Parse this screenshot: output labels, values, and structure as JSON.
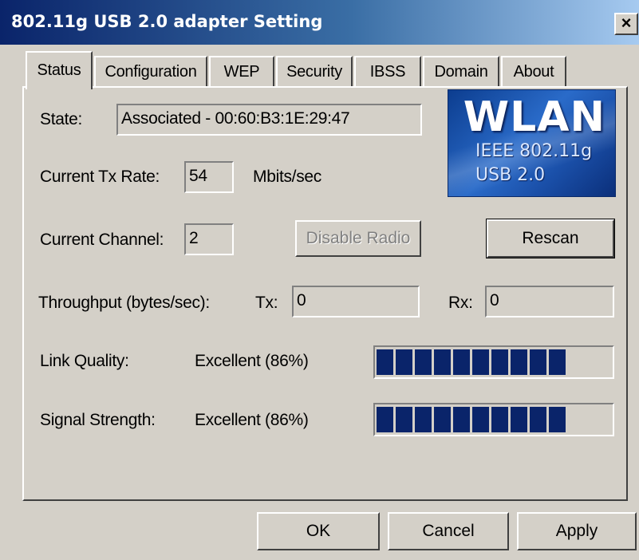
{
  "window": {
    "title": "802.11g USB 2.0 adapter Setting",
    "close_label": "×"
  },
  "tabs": [
    {
      "label": "Status",
      "active": true
    },
    {
      "label": "Configuration",
      "active": false
    },
    {
      "label": "WEP",
      "active": false
    },
    {
      "label": "Security",
      "active": false
    },
    {
      "label": "IBSS",
      "active": false
    },
    {
      "label": "Domain",
      "active": false
    },
    {
      "label": "About",
      "active": false
    }
  ],
  "status": {
    "state_label": "State:",
    "state_value": "Associated - 00:60:B3:1E:29:47",
    "tx_rate_label": "Current Tx Rate:",
    "tx_rate_value": "54",
    "tx_rate_unit": "Mbits/sec",
    "channel_label": "Current Channel:",
    "channel_value": "2",
    "disable_radio_label": "Disable Radio",
    "rescan_label": "Rescan",
    "throughput_label": "Throughput (bytes/sec):",
    "tx_label": "Tx:",
    "tx_value": "0",
    "rx_label": "Rx:",
    "rx_value": "0",
    "link_quality_label": "Link Quality:",
    "link_quality_value": "Excellent (86%)",
    "link_quality_percent": 86,
    "signal_strength_label": "Signal Strength:",
    "signal_strength_value": "Excellent (86%)",
    "signal_strength_percent": 86
  },
  "logo": {
    "title": "WLAN",
    "line1": "IEEE 802.11g",
    "line2": "USB 2.0"
  },
  "footer": {
    "ok_label": "OK",
    "cancel_label": "Cancel",
    "apply_label": "Apply"
  },
  "colors": {
    "titlebar_start": "#0a246a",
    "meter_block": "#0a246a",
    "dialog_face": "#d4d0c8"
  }
}
